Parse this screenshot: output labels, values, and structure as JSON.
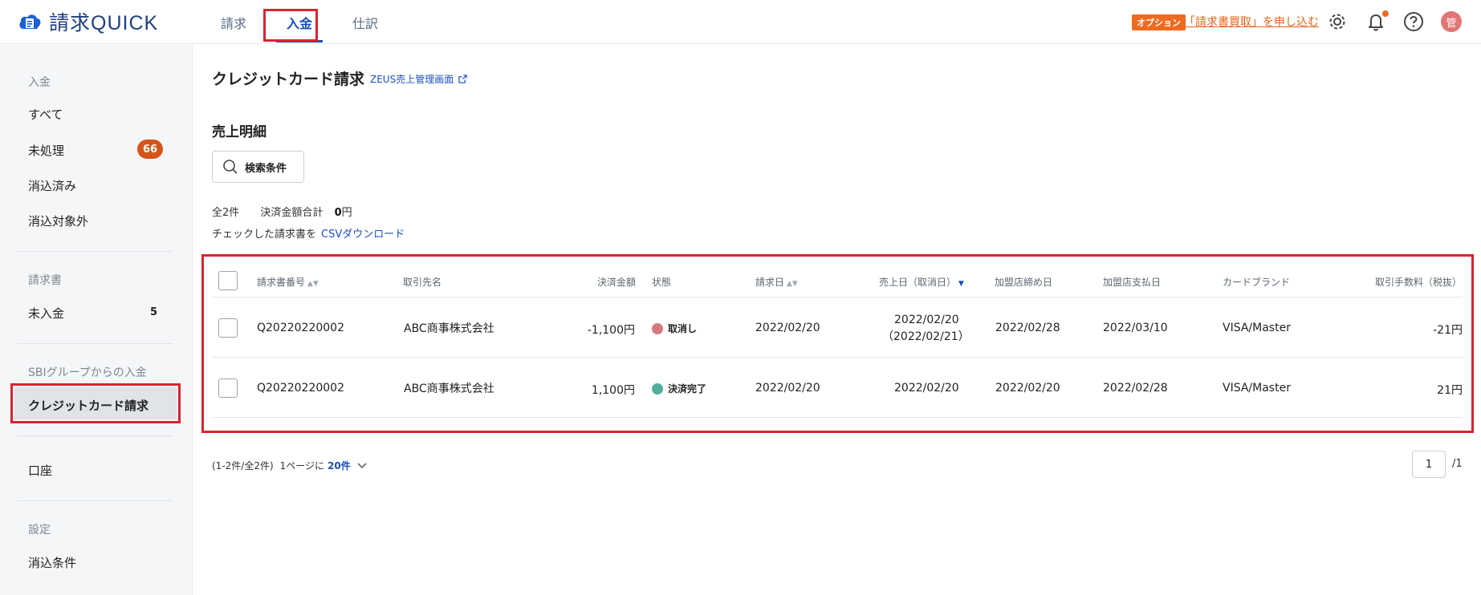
{
  "header": {
    "app_name": "請求QUICK",
    "nav": [
      "請求",
      "入金",
      "仕訳"
    ],
    "option_badge": "オプション",
    "option_link": "「請求書買取」を申し込む",
    "avatar_initial": "管"
  },
  "sidebar": {
    "section_payment": "入金",
    "item_all": "すべて",
    "item_unprocessed": "未処理",
    "unprocessed_count": "66",
    "item_cleared": "消込済み",
    "item_excluded": "消込対象外",
    "section_invoice": "請求書",
    "item_unpaid": "未入金",
    "unpaid_count": "5",
    "section_sbi": "SBIグループからの入金",
    "item_credit": "クレジットカード請求",
    "item_account": "口座",
    "section_settings": "設定",
    "item_clear_conditions": "消込条件"
  },
  "main": {
    "title": "クレジットカード請求",
    "zeus_link": "ZEUS売上管理画面",
    "section_title": "売上明細",
    "search_button": "検索条件",
    "summary_count": "全2件",
    "summary_amount_label": "決済金額合計",
    "summary_amount_value": "0",
    "summary_amount_unit": "円",
    "csv_prefix": "チェックした請求書を",
    "csv_link": "CSVダウンロード"
  },
  "table": {
    "headers": {
      "invoice_no": "請求書番号",
      "client": "取引先名",
      "amount": "決済金額",
      "status": "状態",
      "invoice_date": "請求日",
      "sales_date": "売上日（取消日）",
      "merchant_close": "加盟店締め日",
      "merchant_pay": "加盟店支払日",
      "card_brand": "カードブランド",
      "fee": "取引手数料（税抜）"
    },
    "rows": [
      {
        "invoice_no": "Q20220220002",
        "client": "ABC商事株式会社",
        "amount": "-1,100円",
        "status": "取消し",
        "status_color": "#d47a7a",
        "invoice_date": "2022/02/20",
        "sales_date": "2022/02/20",
        "cancel_date": "（2022/02/21）",
        "merchant_close": "2022/02/28",
        "merchant_pay": "2022/03/10",
        "card_brand": "VISA/Master",
        "fee": "-21円"
      },
      {
        "invoice_no": "Q20220220002",
        "client": "ABC商事株式会社",
        "amount": "1,100円",
        "status": "決済完了",
        "status_color": "#4fae9c",
        "invoice_date": "2022/02/20",
        "sales_date": "2022/02/20",
        "merchant_close": "2022/02/20",
        "merchant_pay": "2022/02/28",
        "card_brand": "VISA/Master",
        "fee": "21円"
      }
    ]
  },
  "pager": {
    "range": "(1-2件/全2件)",
    "per_page_label": "1ページに",
    "per_page_value": "20件",
    "current_page": "1",
    "total_pages": "/1"
  }
}
